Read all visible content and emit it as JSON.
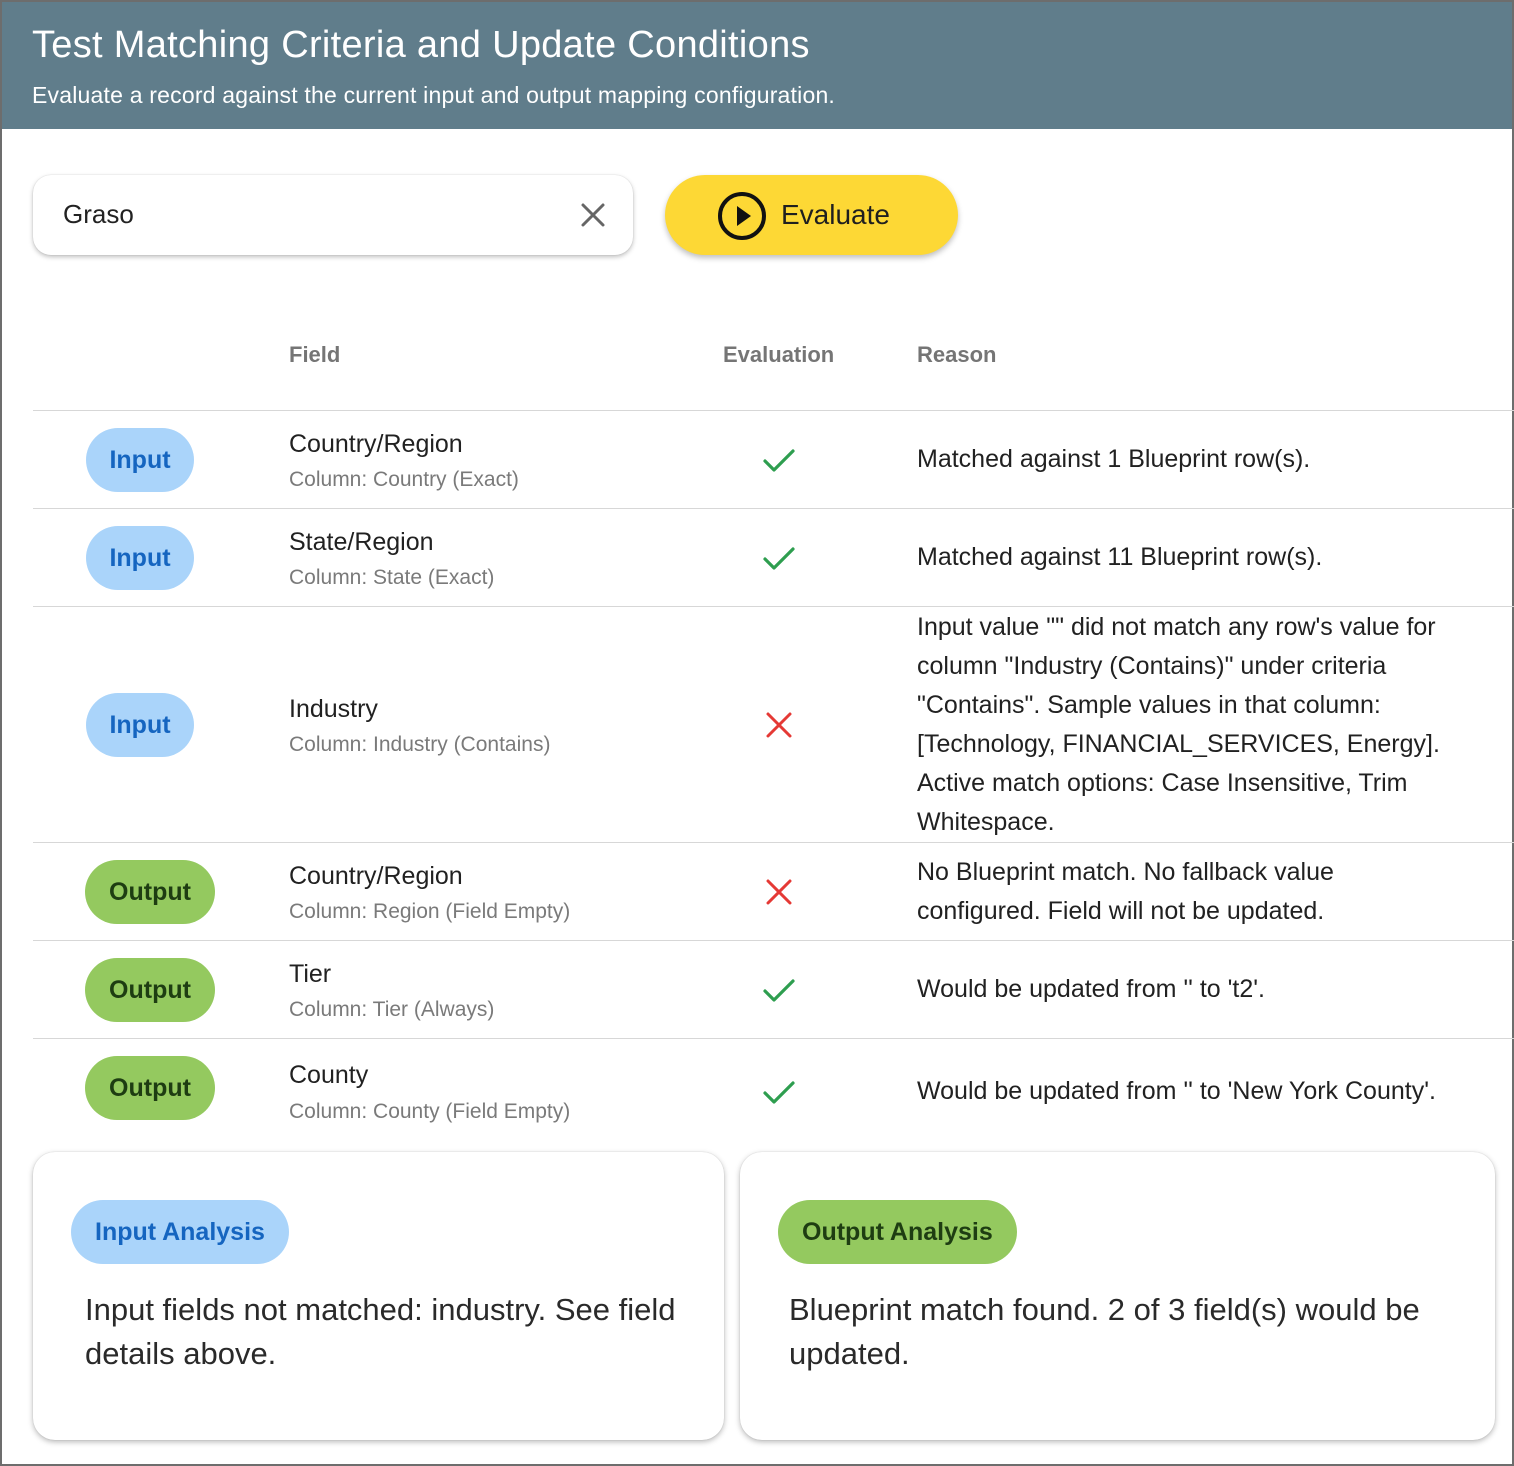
{
  "header": {
    "title": "Test Matching Criteria and Update Conditions",
    "subtitle": "Evaluate a record against the current input and output mapping configuration."
  },
  "search": {
    "value": "Graso"
  },
  "evaluate_button": {
    "label": "Evaluate"
  },
  "table": {
    "headers": {
      "field": "Field",
      "evaluation": "Evaluation",
      "reason": "Reason"
    },
    "rows": [
      {
        "type": "Input",
        "field": "Country/Region",
        "column": "Column: Country (Exact)",
        "evaluation": "pass",
        "reason": "Matched against 1 Blueprint row(s)."
      },
      {
        "type": "Input",
        "field": "State/Region",
        "column": "Column: State (Exact)",
        "evaluation": "pass",
        "reason": "Matched against 11 Blueprint row(s)."
      },
      {
        "type": "Input",
        "field": "Industry",
        "column": "Column: Industry (Contains)",
        "evaluation": "fail",
        "reason": "Input value \"\" did not match any row's value for column \"Industry (Contains)\" under criteria \"Contains\". Sample values in that column: [Technology, FINANCIAL_SERVICES, Energy]. Active match options: Case Insensitive, Trim Whitespace."
      },
      {
        "type": "Output",
        "field": "Country/Region",
        "column": "Column: Region (Field Empty)",
        "evaluation": "fail",
        "reason": "No Blueprint match. No fallback value configured. Field will not be updated."
      },
      {
        "type": "Output",
        "field": "Tier",
        "column": "Column: Tier (Always)",
        "evaluation": "pass",
        "reason": "Would be updated from '' to 't2'."
      },
      {
        "type": "Output",
        "field": "County",
        "column": "Column: County (Field Empty)",
        "evaluation": "pass",
        "reason": "Would be updated from '' to 'New York County'."
      }
    ]
  },
  "input_analysis": {
    "badge": "Input Analysis",
    "text": "Input fields not matched: industry. See field details above."
  },
  "output_analysis": {
    "badge": "Output Analysis",
    "text": "Blueprint match found. 2 of 3 field(s) would be updated."
  },
  "colors": {
    "header_bg": "#607d8b",
    "evaluate_bg": "#fdd835",
    "input_pill_bg": "#aad4fa",
    "output_pill_bg": "#94c95f",
    "pass": "#2e9e4f",
    "fail": "#e53935"
  },
  "icons": {
    "clear": "close-icon",
    "evaluate": "play-circle-icon",
    "pass": "check-icon",
    "fail": "x-icon"
  }
}
